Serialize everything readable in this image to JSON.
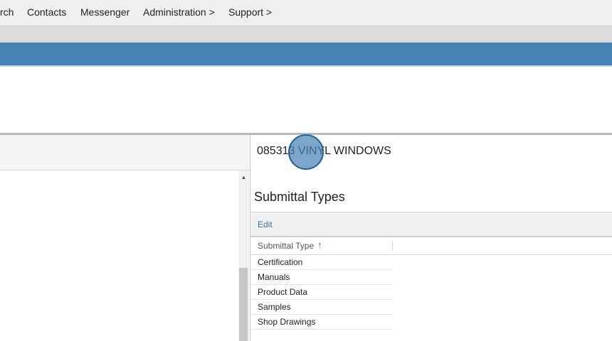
{
  "topnav": {
    "items": [
      "rch",
      "Contacts",
      "Messenger",
      "Administration >",
      "Support >"
    ]
  },
  "spec": {
    "title": "085313 VINYL WINDOWS"
  },
  "submittal_types": {
    "heading": "Submittal Types",
    "edit_label": "Edit",
    "column_header": "Submittal Type",
    "sort_indicator": "↑",
    "rows": [
      "Certification",
      "Manuals",
      "Product Data",
      "Samples",
      "Shop Drawings"
    ]
  },
  "scrollbar": {
    "up_arrow": "▲"
  },
  "colors": {
    "accent_blue": "#4682b4",
    "link_blue": "#3a6ea5",
    "sort_green": "#2e8b2e"
  }
}
